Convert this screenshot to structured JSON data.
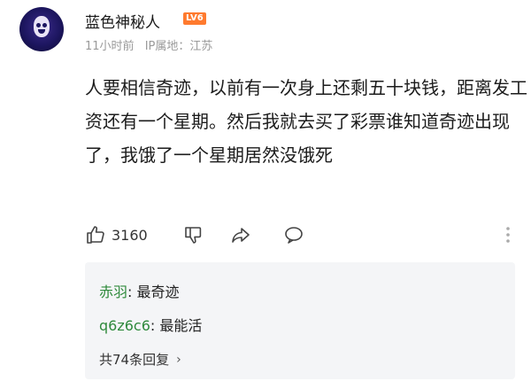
{
  "user": {
    "name": "蓝色神秘人",
    "level": "LV6",
    "time": "11小时前",
    "ip": "IP属地：江苏"
  },
  "post": {
    "text": "人要相信奇迹，以前有一次身上还剩五十块钱，距离发工资还有一个星期。然后我就去买了彩票谁知道奇迹出现了，我饿了一个星期居然没饿死"
  },
  "actions": {
    "like_count": "3160",
    "icons": [
      "thumbs-up-icon",
      "thumbs-down-icon",
      "share-icon",
      "comment-icon",
      "more-icon"
    ]
  },
  "replies": {
    "items": [
      {
        "name": "赤羽",
        "sep": ": ",
        "text": "最奇迹"
      },
      {
        "name": "q6z6c6",
        "sep": ": ",
        "text": "最能活"
      }
    ],
    "more_label": "共74条回复",
    "chevron": "›"
  },
  "colors": {
    "reply_name": "#2f8a3c",
    "level_badge": "#ff7a2e",
    "reply_bg": "#f4f5f7"
  }
}
